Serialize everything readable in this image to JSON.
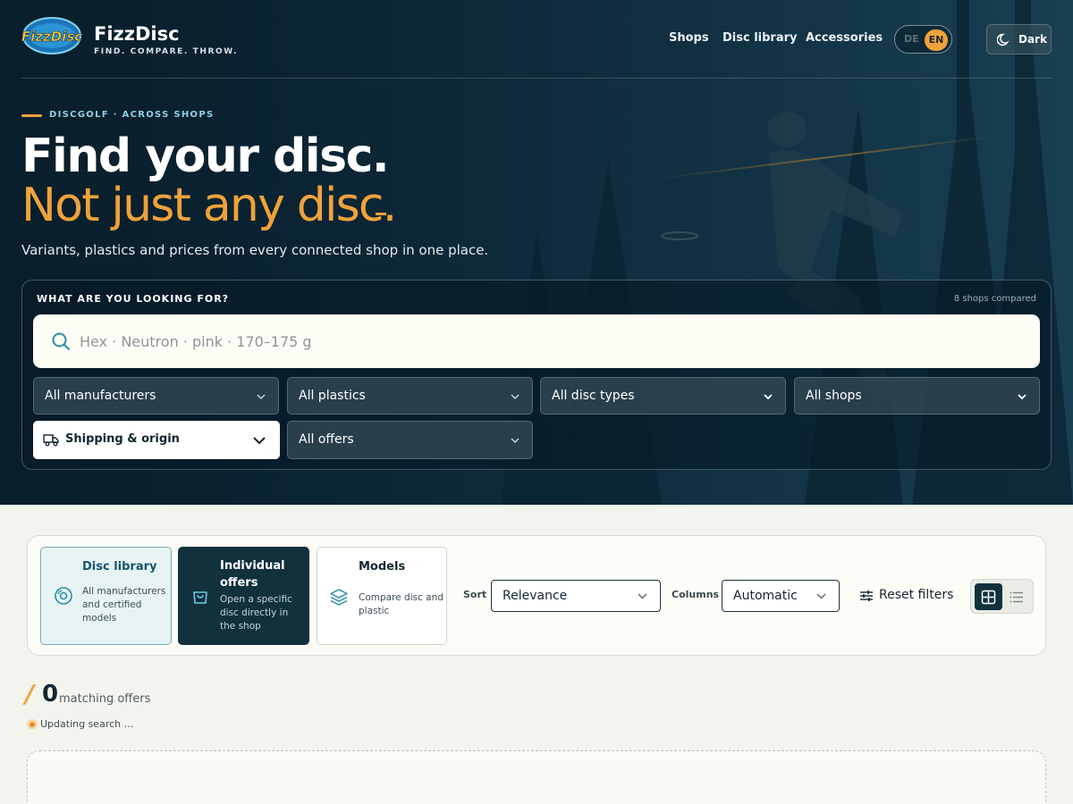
{
  "brand": {
    "name": "FizzDisc",
    "tagline": "FIND. COMPARE. THROW.",
    "logo_text": "FizzDisc"
  },
  "nav": {
    "shops": "Shops",
    "disc_library": "Disc library",
    "accessories": "Accessories"
  },
  "language": {
    "de": "DE",
    "en": "EN",
    "active": "EN"
  },
  "theme": {
    "label": "Dark",
    "icon": "moon-icon"
  },
  "hero": {
    "eyebrow": "DISCGOLF · ACROSS SHOPS",
    "title_line1": "Find your disc.",
    "title_line2": "Not just any disc.",
    "lead": "Variants, plastics and prices from every connected shop in one place."
  },
  "search": {
    "label": "WHAT ARE YOU LOOKING FOR?",
    "shops_compared": "8 shops compared",
    "placeholder": "Hex · Neutron · pink · 170–175 g",
    "value": "",
    "filters": {
      "manufacturers": "All manufacturers",
      "plastics": "All plastics",
      "disc_types": "All disc types",
      "shops": "All shops",
      "shipping": "Shipping & origin",
      "offers": "All offers"
    }
  },
  "modes": [
    {
      "title": "Disc library",
      "desc": "All manufacturers and certified models",
      "icon": "disc-icon",
      "active": false
    },
    {
      "title": "Individual offers",
      "desc": "Open a specific disc directly in the shop",
      "icon": "shopping-bag-icon",
      "active": true
    },
    {
      "title": "Models",
      "desc": "Compare disc and plastic",
      "icon": "layers-icon",
      "active": false
    }
  ],
  "controls": {
    "sort_label": "Sort",
    "sort_value": "Relevance",
    "columns_label": "Columns",
    "columns_value": "Automatic",
    "reset_label": "Reset filters",
    "view": "grid"
  },
  "results": {
    "count": "0",
    "count_label": "matching offers",
    "status": "Updating search ..."
  },
  "colors": {
    "accent": "#f0a23a",
    "navy": "#11313d",
    "page_bg": "#f3f4ee",
    "hero_bg": "#0b2433"
  }
}
